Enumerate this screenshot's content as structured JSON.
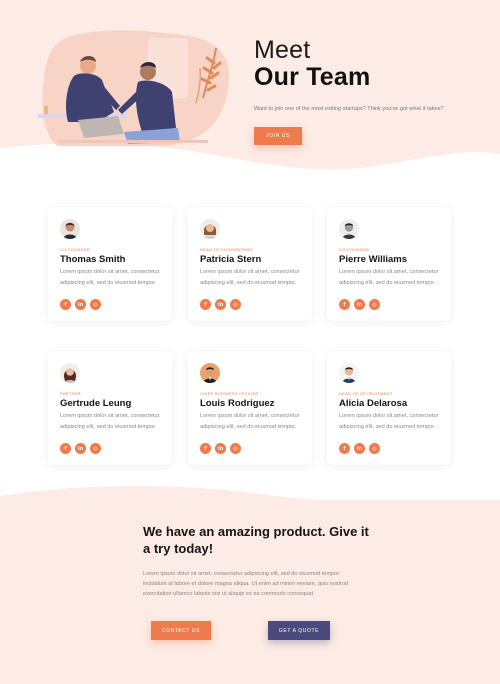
{
  "hero": {
    "title_line1": "Meet",
    "title_line2": "Our Team",
    "subtitle": "Want to join one of the most exiting startups? Think you've got what it takes?",
    "join_label": "JOIN US"
  },
  "team": [
    {
      "role": "CO-FOUNDER",
      "name": "Thomas Smith",
      "desc": "Lorem ipsum dolor sit amet, consectetur adipiscing elit, sed do eiusmod tempor."
    },
    {
      "role": "HEAD OF ENGINEERING",
      "name": "Patricia Stern",
      "desc": "Lorem ipsum dolor sit amet, consectetur adipiscing elit, sed do eiusmod tempor."
    },
    {
      "role": "CO-FOUNDER",
      "name": "Pierre Williams",
      "desc": "Lorem ipsum dolor sit amet, consectetur adipiscing elit, sed do eiusmod tempor."
    },
    {
      "role": "PARTNER",
      "name": "Gertrude Leung",
      "desc": "Lorem ipsum dolor sit amet, consectetur adipiscing elit, sed do eiusmod tempor."
    },
    {
      "role": "CHIEF BUSINESS OFFICER",
      "name": "Louis Rodriguez",
      "desc": "Lorem ipsum dolor sit amet, consectetur adipiscing elit, sed do eiusmod tempor."
    },
    {
      "role": "HEAD OF RECRUITMENT",
      "name": "Alicia Delarosa",
      "desc": "Lorem ipsum dolor sit amet, consectetur adipiscing elit, sed do eiusmod tempor."
    }
  ],
  "social": {
    "facebook": "f",
    "linkedin": "in",
    "instagram": "◎"
  },
  "cta": {
    "title": "We have an amazing product. Give it a try today!",
    "text": "Lorem ipsum dolor sit amet, consectetur adipiscing elit, sed do eiusmod tempor incididunt ut labore et dolore magna aliqua. Ut enim ad minim veniam, quis nostrud exercitation ullamco laboris nisi ut aliquip ex ea commodo consequat.",
    "contact_label": "CONTACT US",
    "quote_label": "GET A QUOTE"
  },
  "colors": {
    "accent": "#ef7a4b",
    "secondary": "#4c4a7a",
    "hero_bg": "#fdebe5"
  }
}
